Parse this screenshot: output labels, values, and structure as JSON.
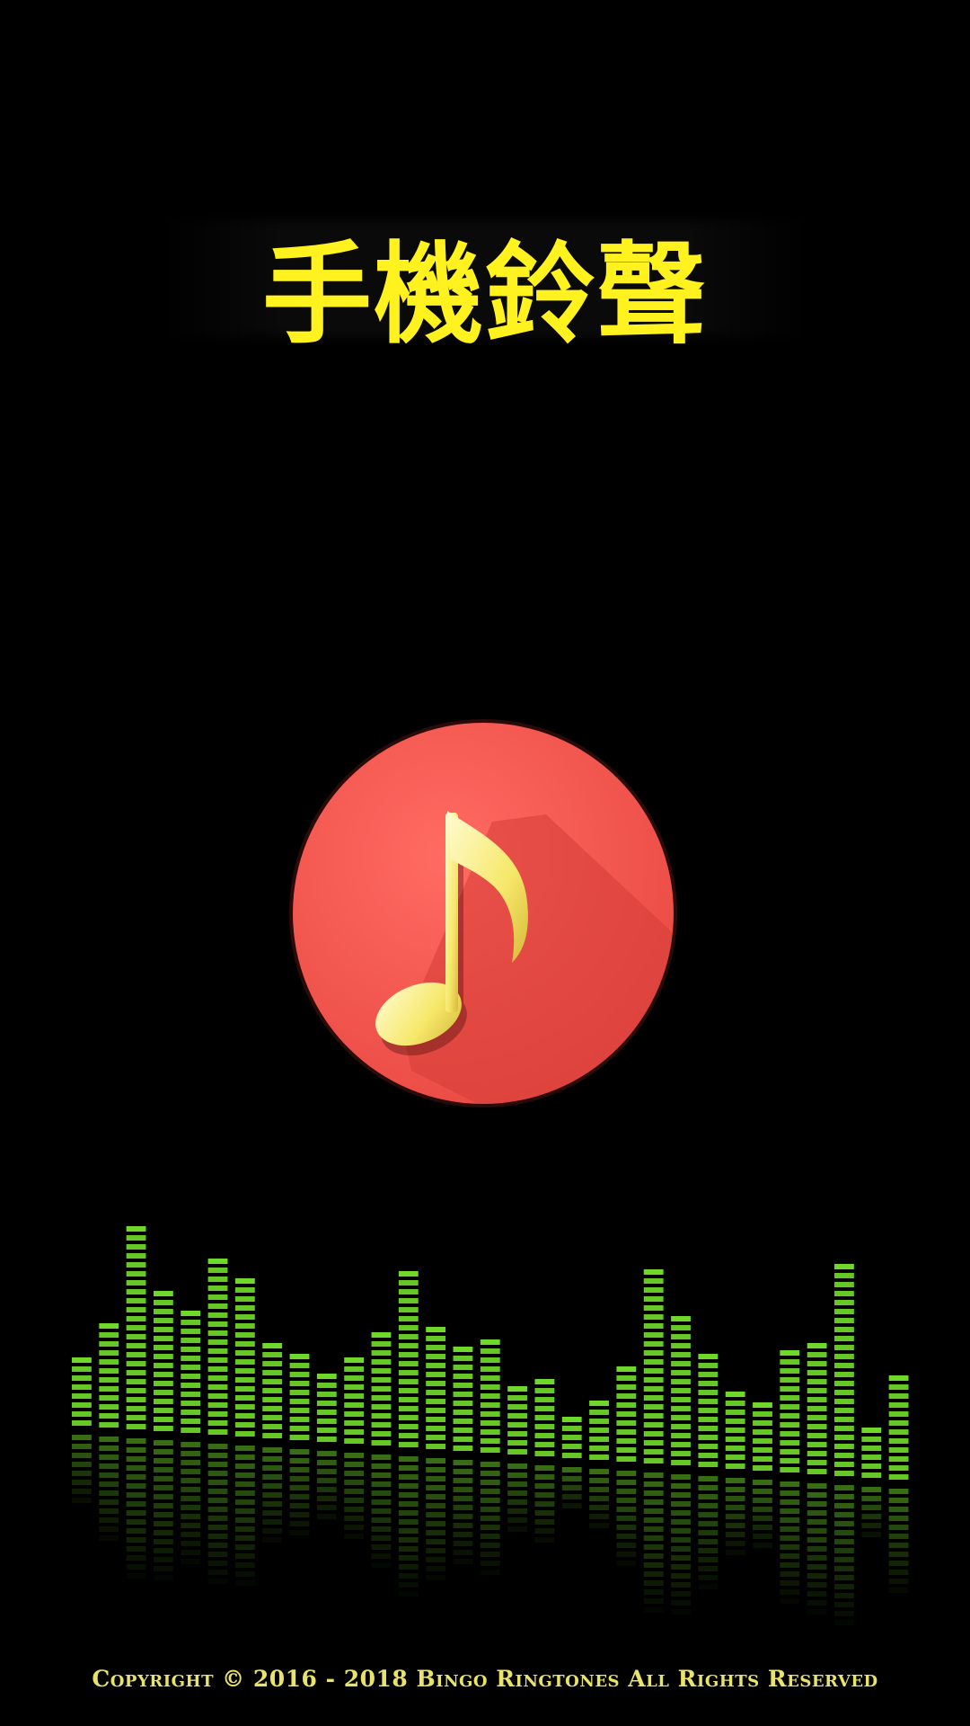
{
  "app": {
    "title": "手機鈴聲",
    "logo_icon": "music-note-icon",
    "copyright": "Copyright © 2016 - 2018 Bingo Ringtones All Rights Reserved"
  },
  "colors": {
    "background": "#000000",
    "title": "#fff21e",
    "logo_circle": "#f4564f",
    "note": "#f7ec7a",
    "equalizer": "#6fd82a",
    "copyright": "#e9e36b"
  },
  "equalizer": {
    "icon": "equalizer-bars-icon",
    "levels": [
      0.34,
      0.52,
      0.95,
      0.66,
      0.58,
      0.84,
      0.74,
      0.44,
      0.4,
      0.34,
      0.42,
      0.56,
      0.82,
      0.6,
      0.52,
      0.56,
      0.34,
      0.38,
      0.22,
      0.3,
      0.44,
      0.9,
      0.72,
      0.56,
      0.38,
      0.34,
      0.58,
      0.64,
      0.98,
      0.26,
      0.52
    ]
  }
}
